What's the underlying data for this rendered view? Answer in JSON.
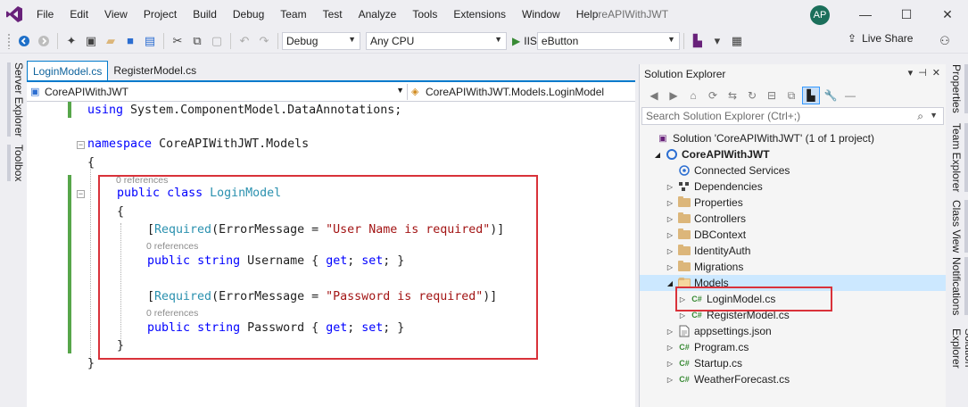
{
  "window": {
    "title_suffix": "reAPIWithJWT",
    "title_prefix": "Help",
    "menu": [
      "File",
      "Edit",
      "View",
      "Project",
      "Build",
      "Debug",
      "Team",
      "Test",
      "Analyze",
      "Tools",
      "Extensions",
      "Window"
    ],
    "avatar": "AP",
    "minimize": "—",
    "restore": "☐",
    "close": "✕"
  },
  "toolbar": {
    "config": "Debug",
    "platform": "Any CPU",
    "run_label": "IIS",
    "startup_combo": "eButton",
    "live_share": "Live Share"
  },
  "left_strip": {
    "server_explorer": "Server Explorer",
    "toolbox": "Toolbox"
  },
  "editor": {
    "tabs": [
      {
        "label": "LoginModel.cs",
        "active": true
      },
      {
        "label": "RegisterModel.cs",
        "active": false
      }
    ],
    "nav_project": "CoreAPIWithJWT",
    "nav_class": "CoreAPIWithJWT.Models.LoginModel",
    "references_label": "0 references",
    "code": {
      "using_kw": "using",
      "using_ns": " System.ComponentModel.DataAnnotations;",
      "namespace_kw": "namespace",
      "namespace_name": " CoreAPIWithJWT.Models",
      "open_brace": "{",
      "close_brace": "}",
      "public_kw": "public",
      "class_kw": "class",
      "class_name": "LoginModel",
      "required_attr": "Required",
      "error_message": "(ErrorMessage = ",
      "username_msg": "\"User Name is required\"",
      "password_msg": "\"Password is required\"",
      "attr_close": ")]",
      "attr_open": "[",
      "string_kw": "string",
      "username_prop": " Username { ",
      "password_prop": " Password { ",
      "get_kw": "get",
      "set_kw": "set",
      "accessor_sep": "; ",
      "accessor_end": "; }"
    }
  },
  "solution_explorer": {
    "title": "Solution Explorer",
    "search_placeholder": "Search Solution Explorer (Ctrl+;)",
    "solution": "Solution 'CoreAPIWithJWT' (1 of 1 project)",
    "project": "CoreAPIWithJWT",
    "items": [
      {
        "label": "Connected Services",
        "icon": "connected-services-icon",
        "indent": 2,
        "expander": ""
      },
      {
        "label": "Dependencies",
        "icon": "dependencies-icon",
        "indent": 2,
        "expander": "▷"
      },
      {
        "label": "Properties",
        "icon": "folder-icon",
        "indent": 2,
        "expander": "▷"
      },
      {
        "label": "Controllers",
        "icon": "folder-icon",
        "indent": 2,
        "expander": "▷"
      },
      {
        "label": "DBContext",
        "icon": "folder-icon",
        "indent": 2,
        "expander": "▷"
      },
      {
        "label": "IdentityAuth",
        "icon": "folder-icon",
        "indent": 2,
        "expander": "▷"
      },
      {
        "label": "Migrations",
        "icon": "folder-icon",
        "indent": 2,
        "expander": "▷"
      },
      {
        "label": "Models",
        "icon": "open-folder-icon",
        "indent": 2,
        "expander": "◢"
      },
      {
        "label": "LoginModel.cs",
        "icon": "csharp-file-icon",
        "indent": 3,
        "expander": "▷"
      },
      {
        "label": "RegisterModel.cs",
        "icon": "csharp-file-icon",
        "indent": 3,
        "expander": "▷"
      },
      {
        "label": "appsettings.json",
        "icon": "json-file-icon",
        "indent": 2,
        "expander": "▷"
      },
      {
        "label": "Program.cs",
        "icon": "csharp-file-icon",
        "indent": 2,
        "expander": "▷"
      },
      {
        "label": "Startup.cs",
        "icon": "csharp-file-icon",
        "indent": 2,
        "expander": "▷"
      },
      {
        "label": "WeatherForecast.cs",
        "icon": "csharp-file-icon",
        "indent": 2,
        "expander": "▷"
      }
    ],
    "csharp_glyph": "C#"
  },
  "right_strip": {
    "properties": "Properties",
    "team_explorer": "Team Explorer",
    "class_view": "Class View",
    "notifications": "Notifications",
    "solution_explorer": "Solution Explorer"
  }
}
